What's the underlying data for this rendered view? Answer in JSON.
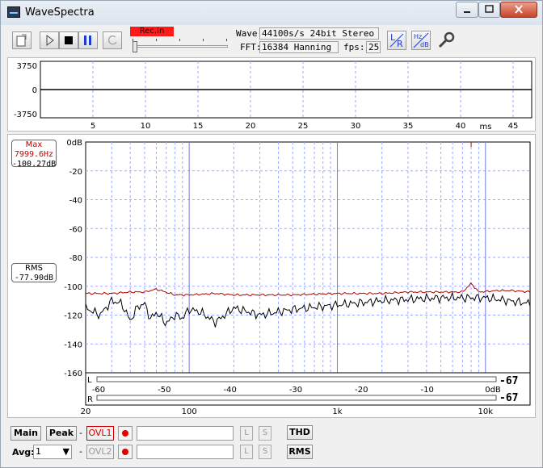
{
  "window": {
    "title": "WaveSpectra",
    "min_icon": "minimize-icon",
    "max_icon": "maximize-icon",
    "close_icon": "close-icon"
  },
  "toolbar": {
    "rec_in_label": "Rec.In",
    "wave_label": "Wave:",
    "wave_value": "44100s/s 24bit Stereo",
    "fft_label": "FFT:",
    "fft_value": "16384 Hanning",
    "fps_label": "fps:",
    "fps_value": "25",
    "lr_label_l": "L",
    "lr_label_r": "R",
    "hz_label": "Hz",
    "db_label": "dB"
  },
  "waveform": {
    "y_ticks": [
      "3750",
      "0",
      "-3750"
    ],
    "x_ticks": [
      "5",
      "10",
      "15",
      "20",
      "25",
      "30",
      "35",
      "40",
      "45"
    ],
    "x_unit": "ms"
  },
  "spectrum": {
    "max_title": "Max",
    "max_freq": "7999.6Hz",
    "max_level": "-100.27dB",
    "rms_title": "RMS",
    "rms_level": "-77.90dB",
    "y_ticks": [
      "0dB",
      "-20",
      "-40",
      "-60",
      "-80",
      "-100",
      "-120",
      "-140",
      "-160"
    ],
    "x_ticks": [
      "20",
      "100",
      "1k",
      "10k"
    ],
    "meter_ticks": [
      "-60",
      "-50",
      "-40",
      "-30",
      "-20",
      "-10",
      "0dB"
    ],
    "meter_l_label": "L",
    "meter_r_label": "R",
    "meter_l_value": "-67",
    "meter_r_value": "-67"
  },
  "chart_data": {
    "type": "line",
    "x_scale": "log",
    "xlim": [
      20,
      20000
    ],
    "ylim": [
      -160,
      0
    ],
    "grid": true,
    "series": [
      {
        "color": "#b00000",
        "x": [
          20,
          30,
          40,
          50,
          60,
          80,
          100,
          150,
          200,
          300,
          500,
          1000,
          2000,
          3000,
          5000,
          7000,
          8000,
          9000,
          12000,
          15000,
          20000
        ],
        "y": [
          -105,
          -105,
          -104,
          -104,
          -102,
          -106,
          -106,
          -105,
          -106,
          -106,
          -106,
          -105,
          -105,
          -104,
          -104,
          -104,
          -98,
          -104,
          -103,
          -103,
          -104
        ]
      },
      {
        "color": "#000000",
        "x": [
          20,
          25,
          30,
          35,
          40,
          45,
          50,
          55,
          60,
          70,
          80,
          90,
          100,
          120,
          150,
          200,
          300,
          500,
          1000,
          2000,
          5000,
          10000,
          20000
        ],
        "y": [
          -115,
          -120,
          -110,
          -112,
          -124,
          -114,
          -112,
          -123,
          -118,
          -126,
          -120,
          -122,
          -116,
          -118,
          -125,
          -115,
          -120,
          -116,
          -113,
          -110,
          -108,
          -108,
          -112
        ]
      }
    ]
  },
  "bottom": {
    "main_label": "Main",
    "peak_label": "Peak",
    "ovl1_label": "OVL1",
    "ovl2_label": "OVL2",
    "avg_label": "Avg:",
    "avg_value": "1",
    "thd_label": "THD",
    "rms_label": "RMS",
    "dash": "-",
    "l_label": "L",
    "s_label": "S"
  }
}
